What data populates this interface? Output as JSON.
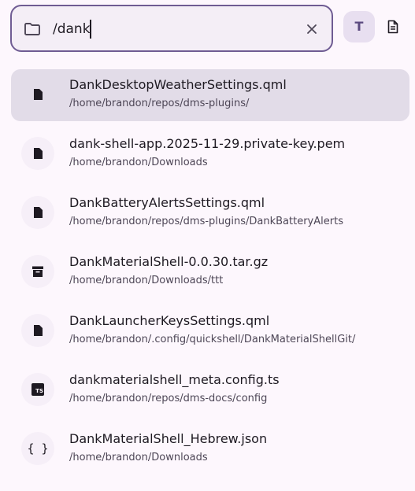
{
  "search": {
    "value": "/dank",
    "mode_label": "T"
  },
  "results": [
    {
      "name": "DankDesktopWeatherSettings.qml",
      "path": "/home/brandon/repos/dms-plugins/",
      "icon": "file-icon"
    },
    {
      "name": "dank-shell-app.2025-11-29.private-key.pem",
      "path": "/home/brandon/Downloads",
      "icon": "file-icon"
    },
    {
      "name": "DankBatteryAlertsSettings.qml",
      "path": "/home/brandon/repos/dms-plugins/DankBatteryAlerts",
      "icon": "file-icon"
    },
    {
      "name": "DankMaterialShell-0.0.30.tar.gz",
      "path": "/home/brandon/Downloads/ttt",
      "icon": "archive-icon"
    },
    {
      "name": "DankLauncherKeysSettings.qml",
      "path": "/home/brandon/.config/quickshell/DankMaterialShellGit/",
      "icon": "file-icon"
    },
    {
      "name": "dankmaterialshell_meta.config.ts",
      "path": "/home/brandon/repos/dms-docs/config",
      "icon": "typescript-icon",
      "badge": "TS"
    },
    {
      "name": "DankMaterialShell_Hebrew.json",
      "path": "/home/brandon/Downloads",
      "icon": "json-braces-icon",
      "glyph": "{ }"
    }
  ]
}
